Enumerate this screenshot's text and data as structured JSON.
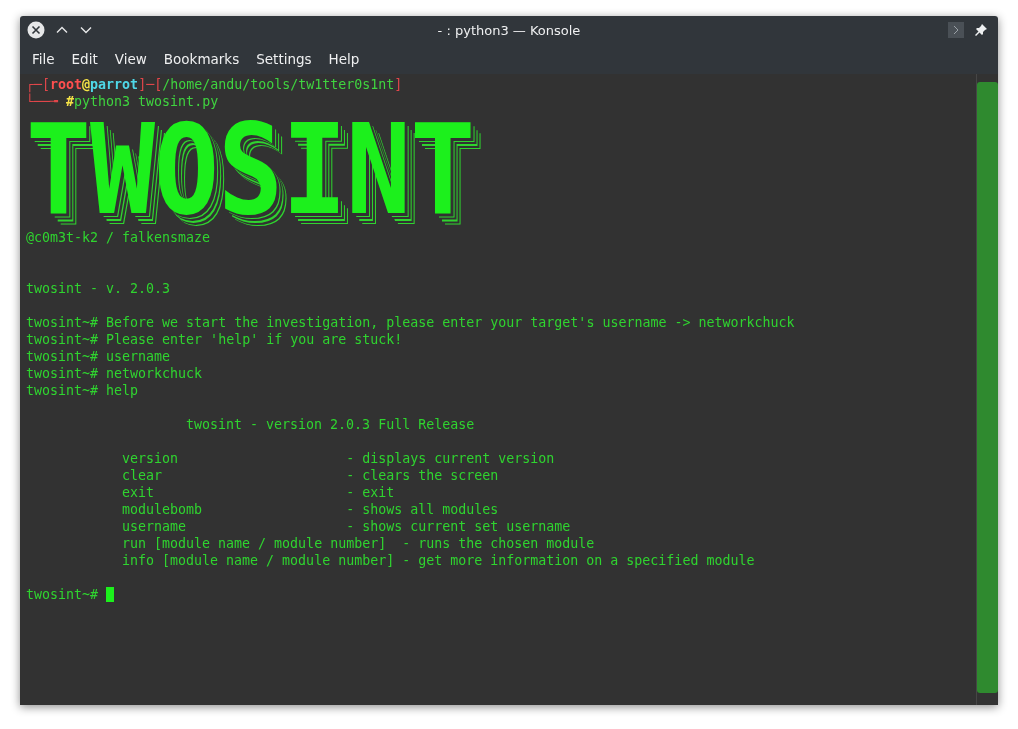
{
  "window": {
    "title": "- : python3 — Konsole"
  },
  "menu": [
    "File",
    "Edit",
    "View",
    "Bookmarks",
    "Settings",
    "Help"
  ],
  "prompt": [
    [
      {
        "kind": "frame",
        "text": "┌─["
      },
      {
        "kind": "user",
        "text": "root"
      },
      {
        "kind": "at",
        "text": "@"
      },
      {
        "kind": "host",
        "text": "parrot"
      },
      {
        "kind": "frame",
        "text": "]─["
      },
      {
        "kind": "path",
        "text": "/home/andu/tools/tw1tter0s1nt"
      },
      {
        "kind": "frame",
        "text": "]"
      }
    ],
    [
      {
        "kind": "frame",
        "text": "└──╼ "
      },
      {
        "kind": "at",
        "text": "#"
      },
      {
        "kind": "path",
        "text": "python3 twosint.py"
      }
    ]
  ],
  "banner": "TWOSINT",
  "output": [
    {
      "kind": "text",
      "text": "@c0m3t-k2 / falkensmaze"
    },
    {
      "kind": "blank"
    },
    {
      "kind": "blank"
    },
    {
      "kind": "text",
      "text": "twosint - v. 2.0.3"
    },
    {
      "kind": "blank"
    },
    {
      "kind": "text",
      "text": "twosint~# Before we start the investigation, please enter your target's username -> networkchuck"
    },
    {
      "kind": "text",
      "text": "twosint~# Please enter 'help' if you are stuck!"
    },
    {
      "kind": "text",
      "text": "twosint~# username"
    },
    {
      "kind": "text",
      "text": "twosint~# networkchuck"
    },
    {
      "kind": "text",
      "text": "twosint~# help"
    },
    {
      "kind": "blank"
    },
    {
      "kind": "heading",
      "text": "twosint - version 2.0.3 Full Release"
    },
    {
      "kind": "blank"
    },
    {
      "kind": "help",
      "text": "version                     - displays current version"
    },
    {
      "kind": "help",
      "text": "clear                       - clears the screen"
    },
    {
      "kind": "help",
      "text": "exit                        - exit"
    },
    {
      "kind": "help",
      "text": "modulebomb                  - shows all modules"
    },
    {
      "kind": "help",
      "text": "username                    - shows current set username"
    },
    {
      "kind": "help",
      "text": "run [module name / module number]  - runs the chosen module"
    },
    {
      "kind": "help",
      "text": "info [module name / module number] - get more information on a specified module"
    },
    {
      "kind": "blank"
    }
  ],
  "input": {
    "prompt": "twosint~#"
  }
}
